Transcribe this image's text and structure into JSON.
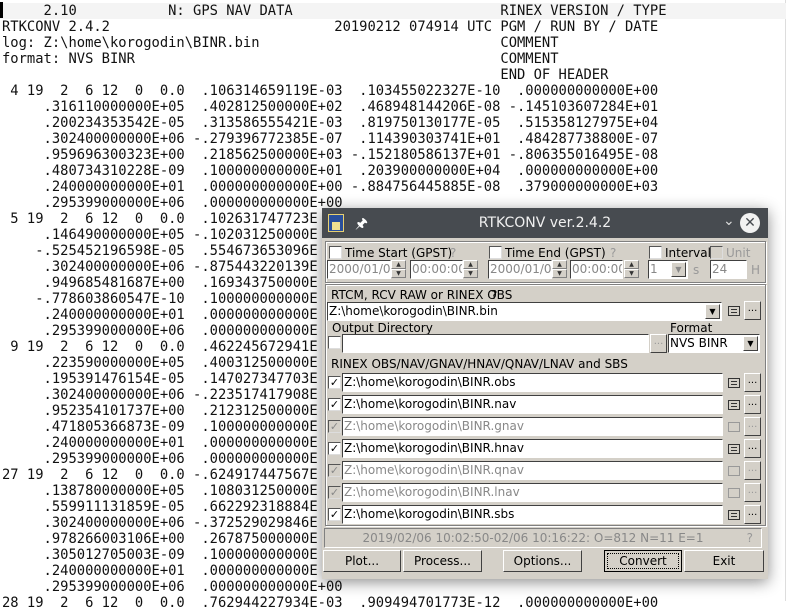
{
  "editor": {
    "lines": [
      "     2.10           N: GPS NAV DATA                         RINEX VERSION / TYPE",
      "RTKCONV 2.4.2                           20190212 074914 UTC PGM / RUN BY / DATE",
      "log: Z:\\home\\korogodin\\BINR.bin                             COMMENT",
      "format: NVS BINR                                            COMMENT",
      "                                                            END OF HEADER",
      " 4 19  2  6 12  0  0.0  .106314659119E-03  .103455022327E-10  .000000000000E+00",
      "     .316110000000E+05  .402812500000E+02  .468948144206E-08 -.145103607284E+01",
      "     .200234353542E-05  .313586555421E-03  .819750130177E-05  .515358127975E+04",
      "     .302400000000E+06 -.279396772385E-07  .114390303741E+01  .484287738800E-07",
      "     .959696300323E+00  .218562500000E+03 -.152180586137E+01 -.806355016495E-08",
      "     .480734310228E-09  .100000000000E+01  .203900000000E+04  .000000000000E+00",
      "     .240000000000E+01  .000000000000E+00 -.884756445885E-08  .379000000000E+03",
      "     .295399000000E+06  .000000000000E+00",
      " 5 19  2  6 12  0  0.0  .102631747723E",
      "     .146490000000E+05 -.102031250000E",
      "    -.525452196598E-05  .554673653096E",
      "     .302400000000E+06 -.875443220139E",
      "     .949685481687E+00  .169343750000E",
      "    -.778603860547E-10  .100000000000E",
      "     .240000000000E+01  .000000000000E",
      "     .295399000000E+06  .000000000000E",
      " 9 19  2  6 12  0  0.0  .462245672941E",
      "     .223590000000E+05  .400312500000E",
      "     .195391476154E-05  .147027347703E",
      "     .302400000000E+06 -.223517417908E",
      "     .952354101737E+00  .212312500000E",
      "     .471805366873E-09  .100000000000E",
      "     .240000000000E+01  .000000000000E",
      "     .295399000000E+06  .000000000000E",
      "27 19  2  6 12  0  0.0 -.624917447567E",
      "     .138780000000E+05  .108031250000E",
      "     .559911131859E-05  .662292318884E",
      "     .302400000000E+06 -.372529029846E",
      "     .978266003106E+00  .267875000000E",
      "     .305012705003E-09  .100000000000E",
      "     .240000000000E+01  .000000000000E",
      "     .295399000000E+06  .000000000000E+00",
      "28 19  2  6 12  0  0.0  .762944227934E-03  .909494701773E-12  .000000000000E+00"
    ]
  },
  "dialog": {
    "title": "RTKCONV ver.2.4.2",
    "app_icon": "rtkconv-app-icon",
    "time_start": {
      "label": "Time Start (GPST)",
      "help": "?",
      "date": "2000/01/01",
      "time": "00:00:00",
      "checked": false
    },
    "time_end": {
      "label": "Time End (GPST)",
      "help": "?",
      "date": "2000/01/01",
      "time": "00:00:00",
      "checked": false
    },
    "interval": {
      "label": "Interval",
      "value": "1",
      "unit": "s",
      "checked": false
    },
    "unit": {
      "label": "Unit",
      "value": "24",
      "unit": "H",
      "checked": false
    },
    "input": {
      "label": "RTCM, RCV RAW or RINEX OBS",
      "help": "?",
      "value": "Z:\\home\\korogodin\\BINR.bin"
    },
    "output_dir": {
      "label": "Output Directory",
      "value": "",
      "checked": false
    },
    "format": {
      "label": "Format",
      "value": "NVS BINR"
    },
    "outputs_label": "RINEX OBS/NAV/GNAV/HNAV/QNAV/LNAV and SBS",
    "outputs": [
      {
        "value": "Z:\\home\\korogodin\\BINR.obs",
        "checked": true,
        "enabled": true
      },
      {
        "value": "Z:\\home\\korogodin\\BINR.nav",
        "checked": true,
        "enabled": true
      },
      {
        "value": "Z:\\home\\korogodin\\BINR.gnav",
        "checked": true,
        "enabled": false
      },
      {
        "value": "Z:\\home\\korogodin\\BINR.hnav",
        "checked": true,
        "enabled": true
      },
      {
        "value": "Z:\\home\\korogodin\\BINR.qnav",
        "checked": true,
        "enabled": false
      },
      {
        "value": "Z:\\home\\korogodin\\BINR.lnav",
        "checked": true,
        "enabled": false
      },
      {
        "value": "Z:\\home\\korogodin\\BINR.sbs",
        "checked": true,
        "enabled": true
      }
    ],
    "status": "2019/02/06 10:02:50-02/06 10:16:22: O=812 N=11 E=1",
    "status_help": "?",
    "buttons": {
      "plot": "Plot...",
      "process": "Process...",
      "options": "Options...",
      "convert": "Convert",
      "exit": "Exit"
    },
    "browse": "..."
  }
}
